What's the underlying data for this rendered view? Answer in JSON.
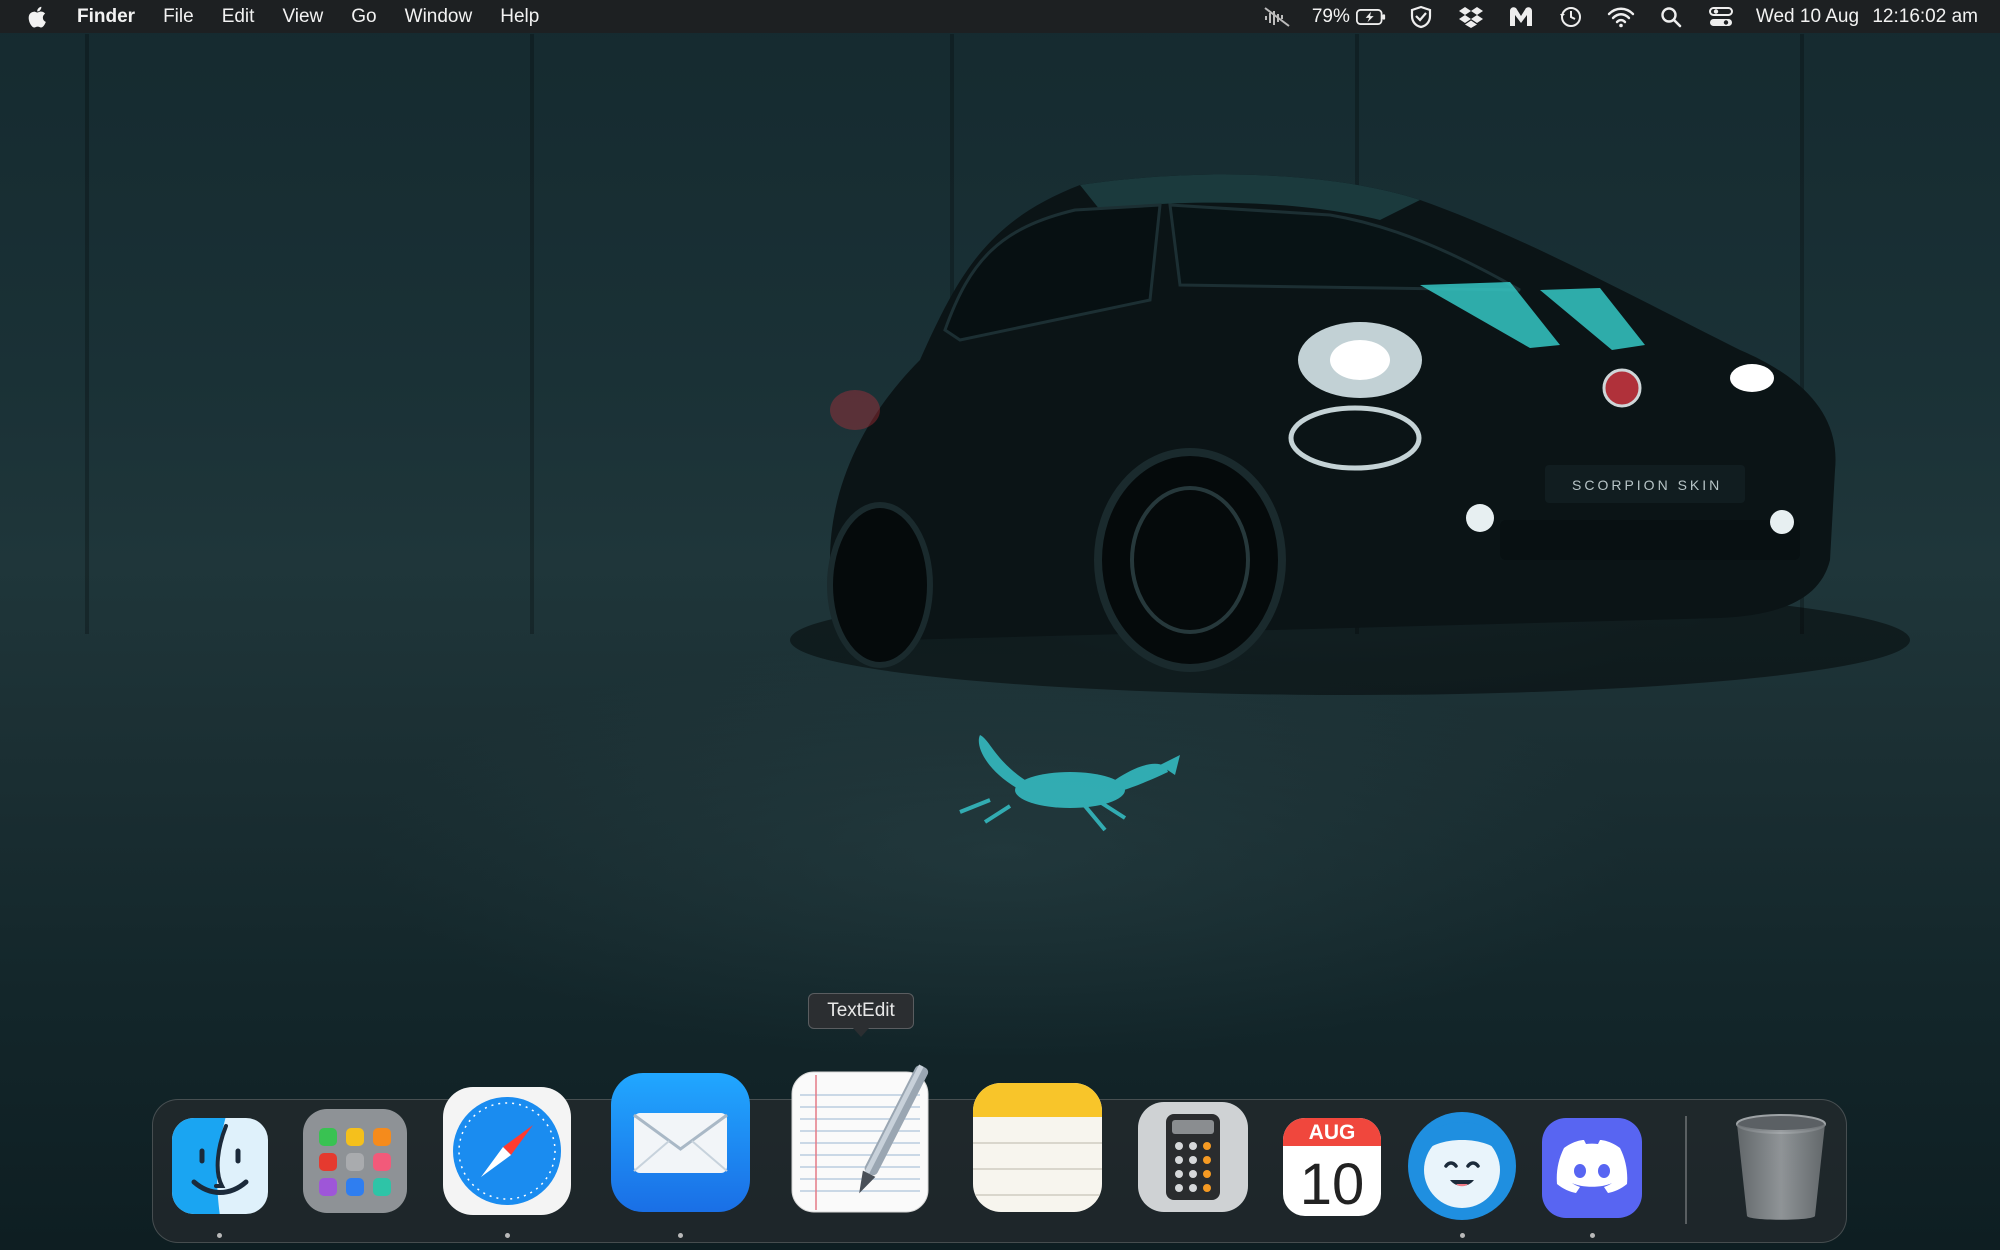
{
  "menubar": {
    "app_name": "Finder",
    "menus": [
      "File",
      "Edit",
      "View",
      "Go",
      "Window",
      "Help"
    ],
    "status": {
      "battery_percent": "79%",
      "date": "Wed 10 Aug",
      "time": "12:16:02 am"
    },
    "icons": [
      "mute-icon",
      "battery-charging-icon",
      "shield-icon",
      "dropbox-icon",
      "malwarebytes-icon",
      "time-machine-icon",
      "wifi-icon",
      "spotlight-search-icon",
      "control-center-icon"
    ]
  },
  "wallpaper": {
    "plate_text": "SCORPION SKIN"
  },
  "dock": {
    "tooltip": "TextEdit",
    "calendar": {
      "month": "AUG",
      "day": "10"
    },
    "apps": [
      "Finder",
      "Launchpad",
      "Safari",
      "Mail",
      "TextEdit",
      "Notes",
      "Calculator",
      "Calendar",
      "Flycut",
      "Discord",
      "Trash"
    ],
    "running": [
      "Finder",
      "Safari",
      "Mail",
      "Flycut",
      "Discord"
    ]
  },
  "colors": {
    "menubar": "#1e2022",
    "accent_teal": "#35c7c4",
    "discord": "#5865f2",
    "safari": "#1a8cf0"
  }
}
